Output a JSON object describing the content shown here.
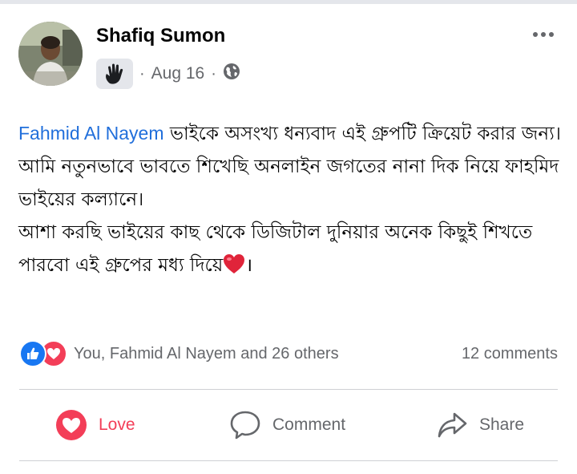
{
  "post": {
    "author": "Shafiq Sumon",
    "date": "Aug 16",
    "dot": "·",
    "icons": {
      "group": "waving-hand-icon",
      "privacy": "globe-icon",
      "more": "more-options-icon"
    }
  },
  "content": {
    "mention": "Fahmid Al Nayem",
    "line1_rest": " ভাইকে অসংখ্য ধন্যবাদ এই গ্রুপটি ক্রিয়েট করার জন্য।",
    "line2": "আমি নতুনভাবে ভাবতে শিখেছি অনলাইন জগতের নানা দিক নিয়ে ফাহমিদ ভাইয়ের কল্যানে।",
    "line3_text": "আশা করছি ভাইয়ের কাছ থেকে ডিজিটাল দুনিয়ার অনেক কিছুই শিখতে পারবো এই গ্রুপের মধ্য দিয়ে",
    "line3_end": "।"
  },
  "reactions": {
    "summary": "You, Fahmid Al Nayem and 26 others",
    "comments": "12 comments",
    "types": [
      "like",
      "love"
    ]
  },
  "actions": {
    "love": "Love",
    "comment": "Comment",
    "share": "Share"
  },
  "colors": {
    "mention": "#216fdb",
    "love": "#f33e58",
    "like": "#1877f2",
    "secondary_text": "#65676b"
  }
}
